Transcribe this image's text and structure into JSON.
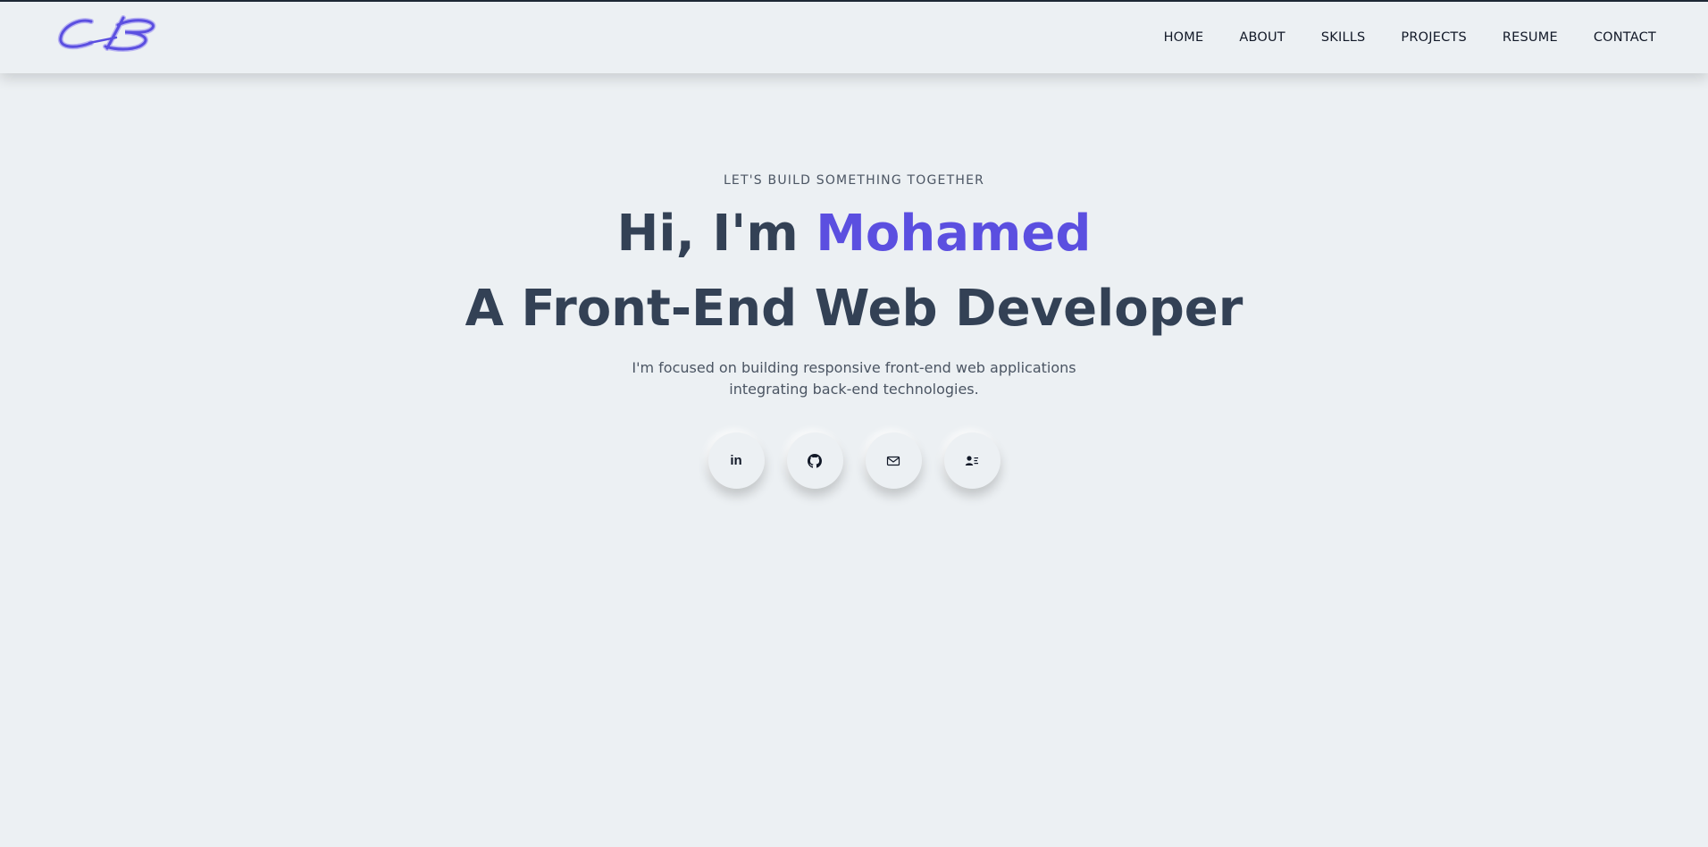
{
  "brand": {
    "logo_icon": "signature-logo-icon",
    "accent_color": "#5b4fe0"
  },
  "nav": {
    "items": [
      {
        "label": "HOME"
      },
      {
        "label": "ABOUT"
      },
      {
        "label": "SKILLS"
      },
      {
        "label": "PROJECTS"
      },
      {
        "label": "RESUME"
      },
      {
        "label": "CONTACT"
      }
    ]
  },
  "hero": {
    "eyebrow": "LET'S BUILD SOMETHING TOGETHER",
    "greeting_prefix": "Hi, I'm ",
    "name": "Mohamed",
    "role": "A Front-End Web Developer",
    "tagline": "I'm focused on building responsive front-end web applications integrating back-end technologies."
  },
  "socials": {
    "linkedin": {
      "icon": "linkedin-icon",
      "glyph": "in"
    },
    "github": {
      "icon": "github-icon"
    },
    "email": {
      "icon": "mail-icon"
    },
    "contact_card": {
      "icon": "contact-card-icon"
    }
  },
  "colors": {
    "background": "#ecf0f3",
    "text_dark": "#334155",
    "text_muted": "#4b5563"
  }
}
